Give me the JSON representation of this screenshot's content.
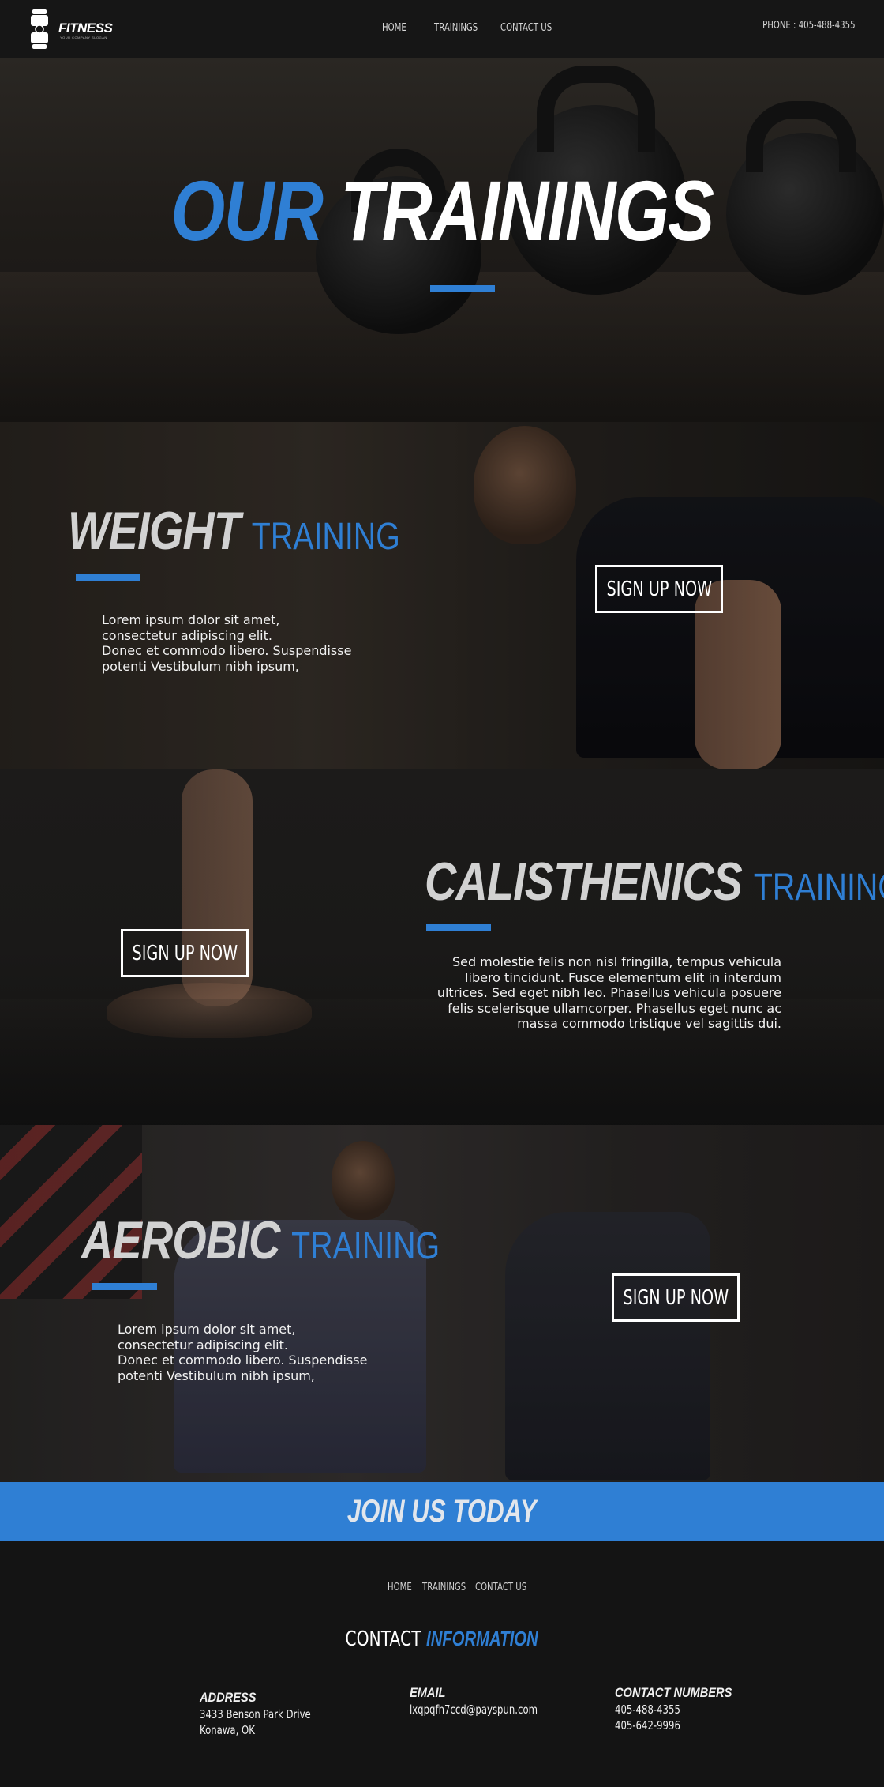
{
  "nav": {
    "logo_text": "FITNESS",
    "logo_tagline": "YOUR COMPANY SLOGAN",
    "links": [
      "HOME",
      "TRAININGS",
      "CONTACT US"
    ],
    "phone": "PHONE : 405-488-4355"
  },
  "hero": {
    "title_accent": "OUR",
    "title_rest": "TRAININGS"
  },
  "sections": [
    {
      "title": "WEIGHT",
      "subtitle": "TRAINING",
      "text": [
        "Lorem ipsum dolor sit amet,",
        "consectetur adipiscing elit.",
        "Donec et commodo libero. Suspendisse",
        "potenti Vestibulum nibh ipsum,"
      ],
      "button": "SIGN UP NOW"
    },
    {
      "title": "CALISTHENICS",
      "subtitle": "TRAINING",
      "text": [
        "Sed molestie felis non nisl fringilla, tempus vehicula",
        "libero tincidunt. Fusce elementum elit in interdum",
        "ultrices. Sed eget nibh leo. Phasellus vehicula posuere",
        "felis scelerisque ullamcorper. Phasellus eget nunc ac",
        "massa commodo tristique vel sagittis dui."
      ],
      "button": "SIGN UP NOW"
    },
    {
      "title": "AEROBIC",
      "subtitle": "TRAINING",
      "text": [
        "Lorem ipsum dolor sit amet,",
        "consectetur adipiscing elit.",
        "Donec et commodo libero. Suspendisse",
        "potenti Vestibulum nibh ipsum,"
      ],
      "button": "SIGN UP NOW"
    }
  ],
  "join": {
    "label": "JOIN US TODAY"
  },
  "footer": {
    "links": [
      "HOME",
      "TRAININGS",
      "CONTACT US"
    ],
    "contact_title": "CONTACT",
    "contact_title_accent": "INFORMATION",
    "address": {
      "heading": "ADDRESS",
      "lines": [
        "3433  Benson Park Drive",
        "Konawa, OK"
      ]
    },
    "email": {
      "heading": "EMAIL",
      "value": "lxqpqfh7ccd@payspun.com"
    },
    "numbers": {
      "heading": "CONTACT NUMBERS",
      "lines": [
        "405-488-4355",
        "405-642-9996"
      ]
    }
  },
  "colors": {
    "accent": "#2f7fd4",
    "background": "#141414",
    "nav": "#161616"
  },
  "icons": [
    "dumbbell-logo-icon"
  ]
}
